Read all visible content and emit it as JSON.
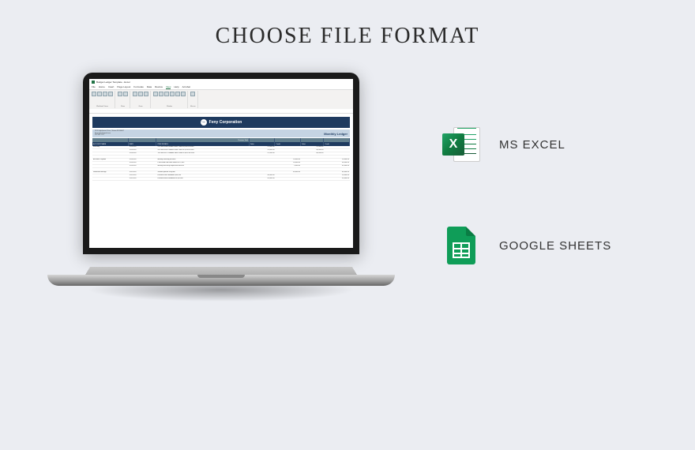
{
  "page": {
    "title": "CHOOSE FILE FORMAT"
  },
  "formats": {
    "excel": {
      "label": "MS EXCEL",
      "glyph": "X"
    },
    "sheets": {
      "label": "GOOGLE SHEETS"
    }
  },
  "laptop": {
    "app_title": "Budget Ledger Template - Excel",
    "ribbon_tabs": [
      "File",
      "Home",
      "Insert",
      "Page Layout",
      "Formulas",
      "Data",
      "Review",
      "View",
      "Help",
      "Acrobat"
    ],
    "active_tab": "View",
    "ribbon_groups": [
      "Normal",
      "Page Break Preview",
      "Page Layout",
      "Custom Views",
      "Gridlines",
      "Headings",
      "Zoom",
      "100%",
      "Zoom to Selection",
      "New Window",
      "Arrange All",
      "Freeze Panes",
      "Split",
      "View Side by Side",
      "Switch Windows",
      "Macros"
    ],
    "workbook_label": "Workbook Views",
    "company": {
      "logo_text": "Logo",
      "name": "Feny Corporation"
    },
    "contact": {
      "line1": "2120 Lighthouse Drive, Ottawa KS 66067",
      "line2": "fenycorpo@email.com",
      "line3": "222 555 7777"
    },
    "ledger_title": "Monthly Ledger",
    "previous_total_label": "Previous Total",
    "columns": [
      "ACCOUNT NAME",
      "DATE",
      "ITEM DETAILS",
      "Debit",
      "Credit",
      "Debit",
      "Credit"
    ],
    "column_groups": [
      "",
      "",
      "",
      "TRANSACTIONS",
      "",
      "BALANCE",
      ""
    ],
    "rows": [
      {
        "account": "Inventory",
        "date": "1/20/2020",
        "details": "220 units M-A Portable Solar Panel at $100.00 each",
        "debit": "22,000.00",
        "credit": "",
        "bdebit": "22,000.00",
        "bcredit": ""
      },
      {
        "account": "",
        "date": "1/20/2020",
        "details": "200 units M-B Portable Solar Panel at $120.00 each",
        "debit": "24,000.00",
        "credit": "",
        "bdebit": "46,000.00",
        "bcredit": ""
      },
      {
        "account": "",
        "date": "1/20/2020",
        "details": "150 units M-C Foldable Solar Panel at $150.00 each",
        "debit": "22,500.00",
        "credit": "",
        "bdebit": "68,500.00",
        "bcredit": ""
      },
      {
        "account": "",
        "date": "",
        "details": "",
        "debit": "",
        "credit": "",
        "bdebit": "",
        "bcredit": ""
      },
      {
        "account": "Accounts Payable",
        "date": "1/20/2020",
        "details": "Monthly cleaning services",
        "debit": "",
        "credit": "20,000.00",
        "bdebit": "",
        "bcredit": "20,000.00"
      },
      {
        "account": "",
        "date": "1/20/2020",
        "details": "Purchased M-A units valued at 22,000",
        "debit": "",
        "credit": "18,000.00",
        "bdebit": "",
        "bcredit": "38,000.00"
      },
      {
        "account": "",
        "date": "1/20/2020",
        "details": "Monthly electricity inspection services",
        "debit": "",
        "credit": "5,000.00",
        "bdebit": "",
        "bcredit": "43,000.00"
      },
      {
        "account": "",
        "date": "",
        "details": "",
        "debit": "",
        "credit": "",
        "bdebit": "",
        "bcredit": ""
      },
      {
        "account": "Retained Earnings",
        "date": "1/31/2020",
        "details": "Second quarter net profit",
        "debit": "",
        "credit": "80,000.00",
        "bdebit": "",
        "bcredit": "80,000.00"
      },
      {
        "account": "",
        "date": "1/31/2020",
        "details": "Declared cash dividends $30,000",
        "debit": "30,000.00",
        "credit": "",
        "bdebit": "",
        "bcredit": "50,000.00"
      },
      {
        "account": "",
        "date": "1/31/2020",
        "details": "Declared stock dividends at $20,000",
        "debit": "20,000.00",
        "credit": "",
        "bdebit": "",
        "bcredit": "30,000.00"
      }
    ]
  }
}
